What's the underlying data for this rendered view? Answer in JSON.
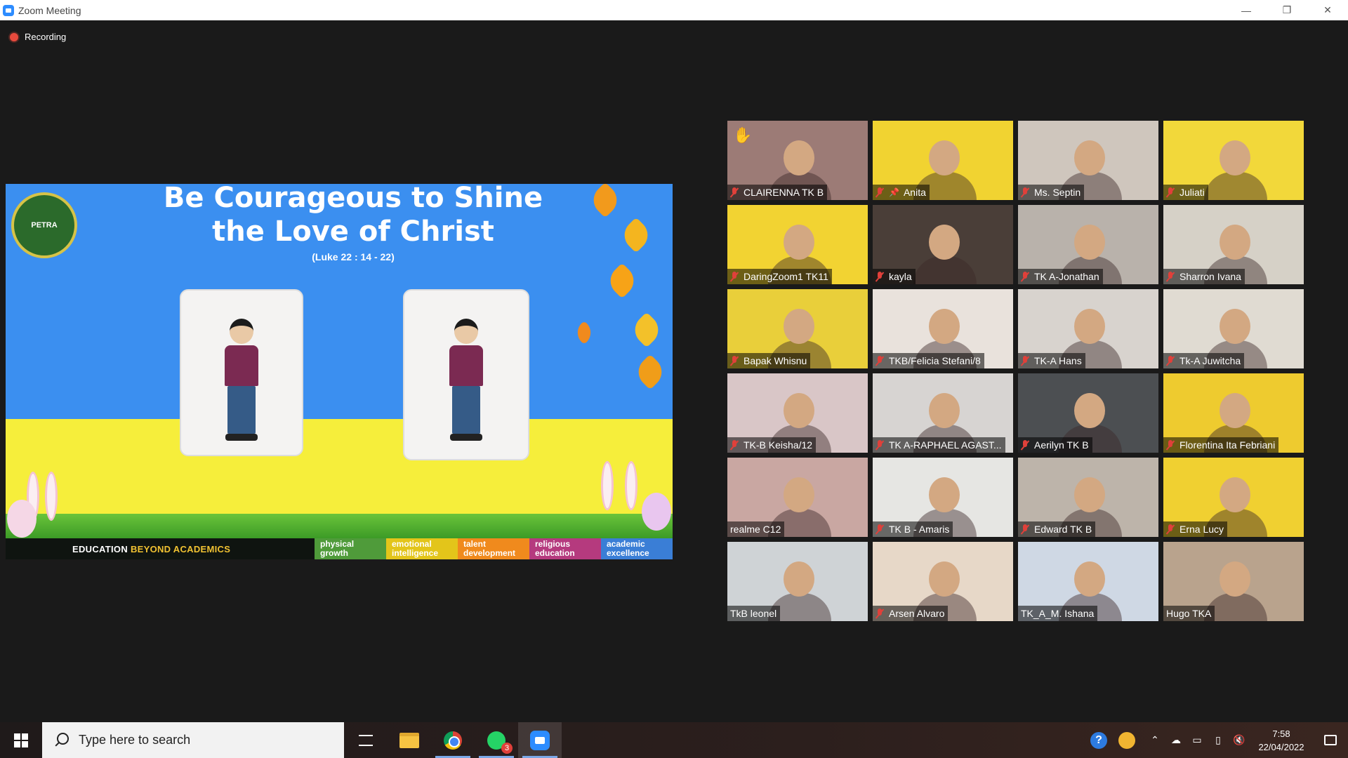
{
  "window": {
    "title": "Zoom Meeting",
    "minimize": "—",
    "restore": "❐",
    "close": "✕"
  },
  "recording": {
    "label": "Recording"
  },
  "share": {
    "title_line1": "Be Courageous to Shine",
    "title_line2": "the Love of Christ",
    "subtitle": "(Luke 22 : 14 - 22)",
    "logo_text": "PETRA",
    "footer": {
      "edu_part1": "EDUCATION",
      "edu_part2": "BEYOND ACADEMICS",
      "pillars": [
        {
          "line1": "physical",
          "line2": "growth",
          "color": "#4f9b3a"
        },
        {
          "line1": "emotional",
          "line2": "intelligence",
          "color": "#e3c51a"
        },
        {
          "line1": "talent",
          "line2": "development",
          "color": "#f08a1d"
        },
        {
          "line1": "religious",
          "line2": "education",
          "color": "#b53a7e"
        },
        {
          "line1": "academic",
          "line2": "excellence",
          "color": "#3a7ed6"
        }
      ]
    }
  },
  "participants": [
    {
      "name": "CLAIRENNA TK B",
      "muted": true,
      "bg": "#9c7b76",
      "hand": true
    },
    {
      "name": "Anita",
      "muted": true,
      "bg": "#f1d331",
      "active": true,
      "pinned": true
    },
    {
      "name": "Ms. Septin",
      "muted": true,
      "bg": "#cfc6bd"
    },
    {
      "name": "Juliati",
      "muted": true,
      "bg": "#f2d83a"
    },
    {
      "name": "DaringZoom1 TK11",
      "muted": true,
      "bg": "#f2d332"
    },
    {
      "name": "kayla",
      "muted": true,
      "bg": "#4a3e38"
    },
    {
      "name": "TK A-Jonathan",
      "muted": true,
      "bg": "#b9b2ab"
    },
    {
      "name": "Sharron Ivana",
      "muted": true,
      "bg": "#d6d1c7"
    },
    {
      "name": "Bapak Whisnu",
      "muted": true,
      "bg": "#e9cf3a"
    },
    {
      "name": "TKB/Felicia Stefani/8",
      "muted": true,
      "bg": "#e9e2dc"
    },
    {
      "name": "TK-A Hans",
      "muted": true,
      "bg": "#d8d3ce"
    },
    {
      "name": "Tk-A Juwitcha",
      "muted": true,
      "bg": "#e0dbd2"
    },
    {
      "name": "TK-B Keisha/12",
      "muted": true,
      "bg": "#d9c6c7"
    },
    {
      "name": "TK A-RAPHAEL AGAST...",
      "muted": true,
      "bg": "#d7d4d2"
    },
    {
      "name": "Aerilyn TK B",
      "muted": true,
      "bg": "#4c4f52"
    },
    {
      "name": "Florentina Ita Febriani",
      "muted": true,
      "bg": "#eecb2f"
    },
    {
      "name": "realme C12",
      "muted": false,
      "bg": "#c9a7a2"
    },
    {
      "name": "TK B - Amaris",
      "muted": true,
      "bg": "#e6e6e3"
    },
    {
      "name": "Edward TK B",
      "muted": true,
      "bg": "#bdb4aa"
    },
    {
      "name": "Erna Lucy",
      "muted": true,
      "bg": "#f0d031"
    },
    {
      "name": "TkB leonel",
      "muted": false,
      "bg": "#cfd3d6"
    },
    {
      "name": "Arsen Alvaro",
      "muted": true,
      "bg": "#e7d8c8"
    },
    {
      "name": "TK_A_M. Ishana",
      "muted": false,
      "bg": "#cfd8e4"
    },
    {
      "name": "Hugo TKA",
      "muted": false,
      "bg": "#b9a38d"
    }
  ],
  "taskbar": {
    "search_placeholder": "Type here to search",
    "whatsapp_badge": "3",
    "time": "7:58",
    "date": "22/04/2022",
    "help": "?"
  }
}
